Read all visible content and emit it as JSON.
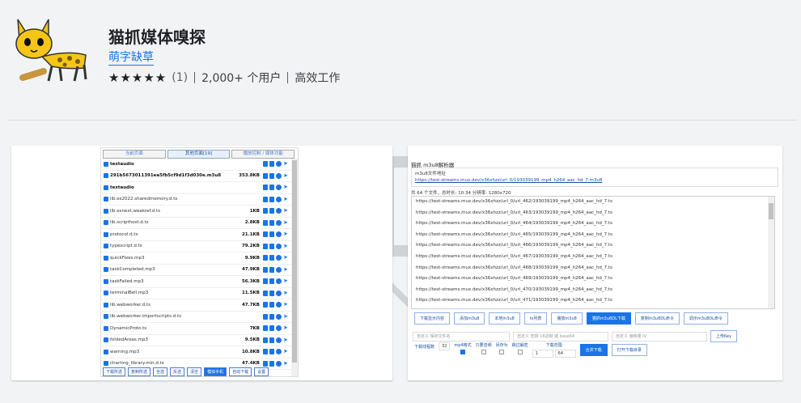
{
  "extension": {
    "title": "猫抓媒体嗅探",
    "author": "萌字缺草",
    "stars": "★★★★★",
    "rating_count": "(1)",
    "users": "2,000+ 个用户",
    "category": "高效工作"
  },
  "colors": {
    "accent": "#1a73e8",
    "page_bg": "#f1f3f4"
  },
  "screenshot1": {
    "tabs": [
      "当前页面",
      "其他页面[19]",
      "播放控制 / 媒体功能"
    ],
    "rows": [
      {
        "name": "textaudio",
        "size": "",
        "bold": true
      },
      {
        "name": "291b5673011391ea5fb5cf9d1f3d030e.m3u8",
        "size": "353.8KB",
        "bold": true
      },
      {
        "name": "textaudio",
        "size": "",
        "bold": true
      },
      {
        "name": "lib.es2022.sharedmemory.d.ts",
        "size": "",
        "bold": false
      },
      {
        "name": "lib.esnext.weakref.d.ts",
        "size": "1KB",
        "bold": false
      },
      {
        "name": "lib.scripthost.d.ts",
        "size": "2.8KB",
        "bold": false
      },
      {
        "name": "protocol.d.ts",
        "size": "21.1KB",
        "bold": false
      },
      {
        "name": "typescript.d.ts",
        "size": "79.2KB",
        "bold": false
      },
      {
        "name": "quickFixes.mp3",
        "size": "9.9KB",
        "bold": false
      },
      {
        "name": "taskCompleted.mp3",
        "size": "47.9KB",
        "bold": false
      },
      {
        "name": "taskFailed.mp3",
        "size": "56.3KB",
        "bold": false
      },
      {
        "name": "terminalBell.mp3",
        "size": "11.5KB",
        "bold": false
      },
      {
        "name": "lib.webworker.d.ts",
        "size": "47.7KB",
        "bold": false
      },
      {
        "name": "lib.webworker.importscripts.d.ts",
        "size": "",
        "bold": false
      },
      {
        "name": "DynamicProto.ts",
        "size": "7KB",
        "bold": false
      },
      {
        "name": "foldedAreas.mp3",
        "size": "9.5KB",
        "bold": false
      },
      {
        "name": "warning.mp3",
        "size": "10.8KB",
        "bold": false
      },
      {
        "name": "charting_library.min.d.ts",
        "size": "47.4KB",
        "bold": false
      }
    ],
    "buttons": [
      "下载所选",
      "复制所选",
      "全选",
      "反选",
      "清空",
      "模拟手机",
      "自动下载",
      "设置"
    ]
  },
  "screenshot2": {
    "title": "猫抓 m3u8解析器",
    "url_label": "m3u8文件地址",
    "url": "https://test-streams.mux.dev/x36xhzz/url_0/193039199_mp4_h264_aac_hd_7.m3u8",
    "info": "共 64 个文件，总时长: 10:34 分辨率: 1280x720",
    "list": [
      "https://test-streams.mux.dev/x36xhzz/url_0/url_462/193039199_mp4_h264_aac_hd_7.ts",
      "https://test-streams.mux.dev/x36xhzz/url_0/url_463/193039199_mp4_h264_aac_hd_7.ts",
      "https://test-streams.mux.dev/x36xhzz/url_0/url_464/193039199_mp4_h264_aac_hd_7.ts",
      "https://test-streams.mux.dev/x36xhzz/url_0/url_465/193039199_mp4_h264_aac_hd_7.ts",
      "https://test-streams.mux.dev/x36xhzz/url_0/url_466/193039199_mp4_h264_aac_hd_7.ts",
      "https://test-streams.mux.dev/x36xhzz/url_0/url_467/193039199_mp4_h264_aac_hd_7.ts",
      "https://test-streams.mux.dev/x36xhzz/url_0/url_468/193039199_mp4_h264_aac_hd_7.ts",
      "https://test-streams.mux.dev/x36xhzz/url_0/url_469/193039199_mp4_h264_aac_hd_7.ts",
      "https://test-streams.mux.dev/x36xhzz/url_0/url_470/193039199_mp4_h264_aac_hd_7.ts",
      "https://test-streams.mux.dev/x36xhzz/url_0/url_471/193039199_mp4_h264_aac_hd_7.ts"
    ],
    "buttons": [
      "下载显示内容",
      "添加m3u8",
      "本地m3u8",
      "ts列表",
      "播放m3u8",
      "猫抓m3u8DL下载",
      "复制m3u8DL命令",
      "调示m3u8DL命令"
    ],
    "inputs": [
      "自定义 保存文件名",
      "自定义 密钥 16进制 或 base64",
      "自定义 偏移量 IV"
    ],
    "upload_key": "上传Key",
    "thread_label": "下载线程数",
    "thread_value": "32",
    "options": [
      "mp4格式",
      "只要音频",
      "另存为",
      "跳过解密"
    ],
    "range_label": "下载范围",
    "range_start": "1",
    "range_end": "64",
    "merge": "合并下载",
    "open_dir": "打开下载目录"
  }
}
